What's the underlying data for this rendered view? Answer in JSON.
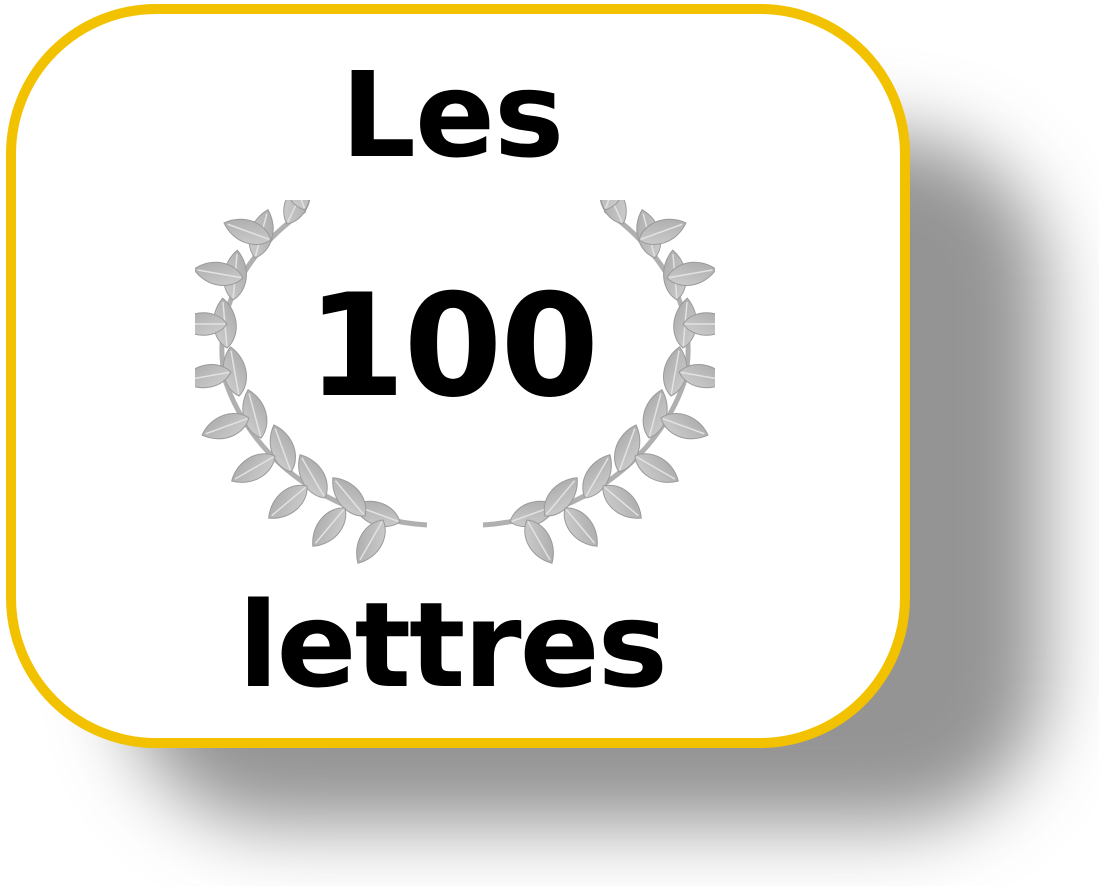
{
  "badge": {
    "line_top": "Les",
    "line_number": "100",
    "line_bottom": "lettres"
  },
  "colors": {
    "border": "#f2c200",
    "background": "#ffffff",
    "text": "#000000",
    "laurel": "#b9b9b9"
  },
  "icons": {
    "laurel": "laurel-wreath-icon"
  }
}
